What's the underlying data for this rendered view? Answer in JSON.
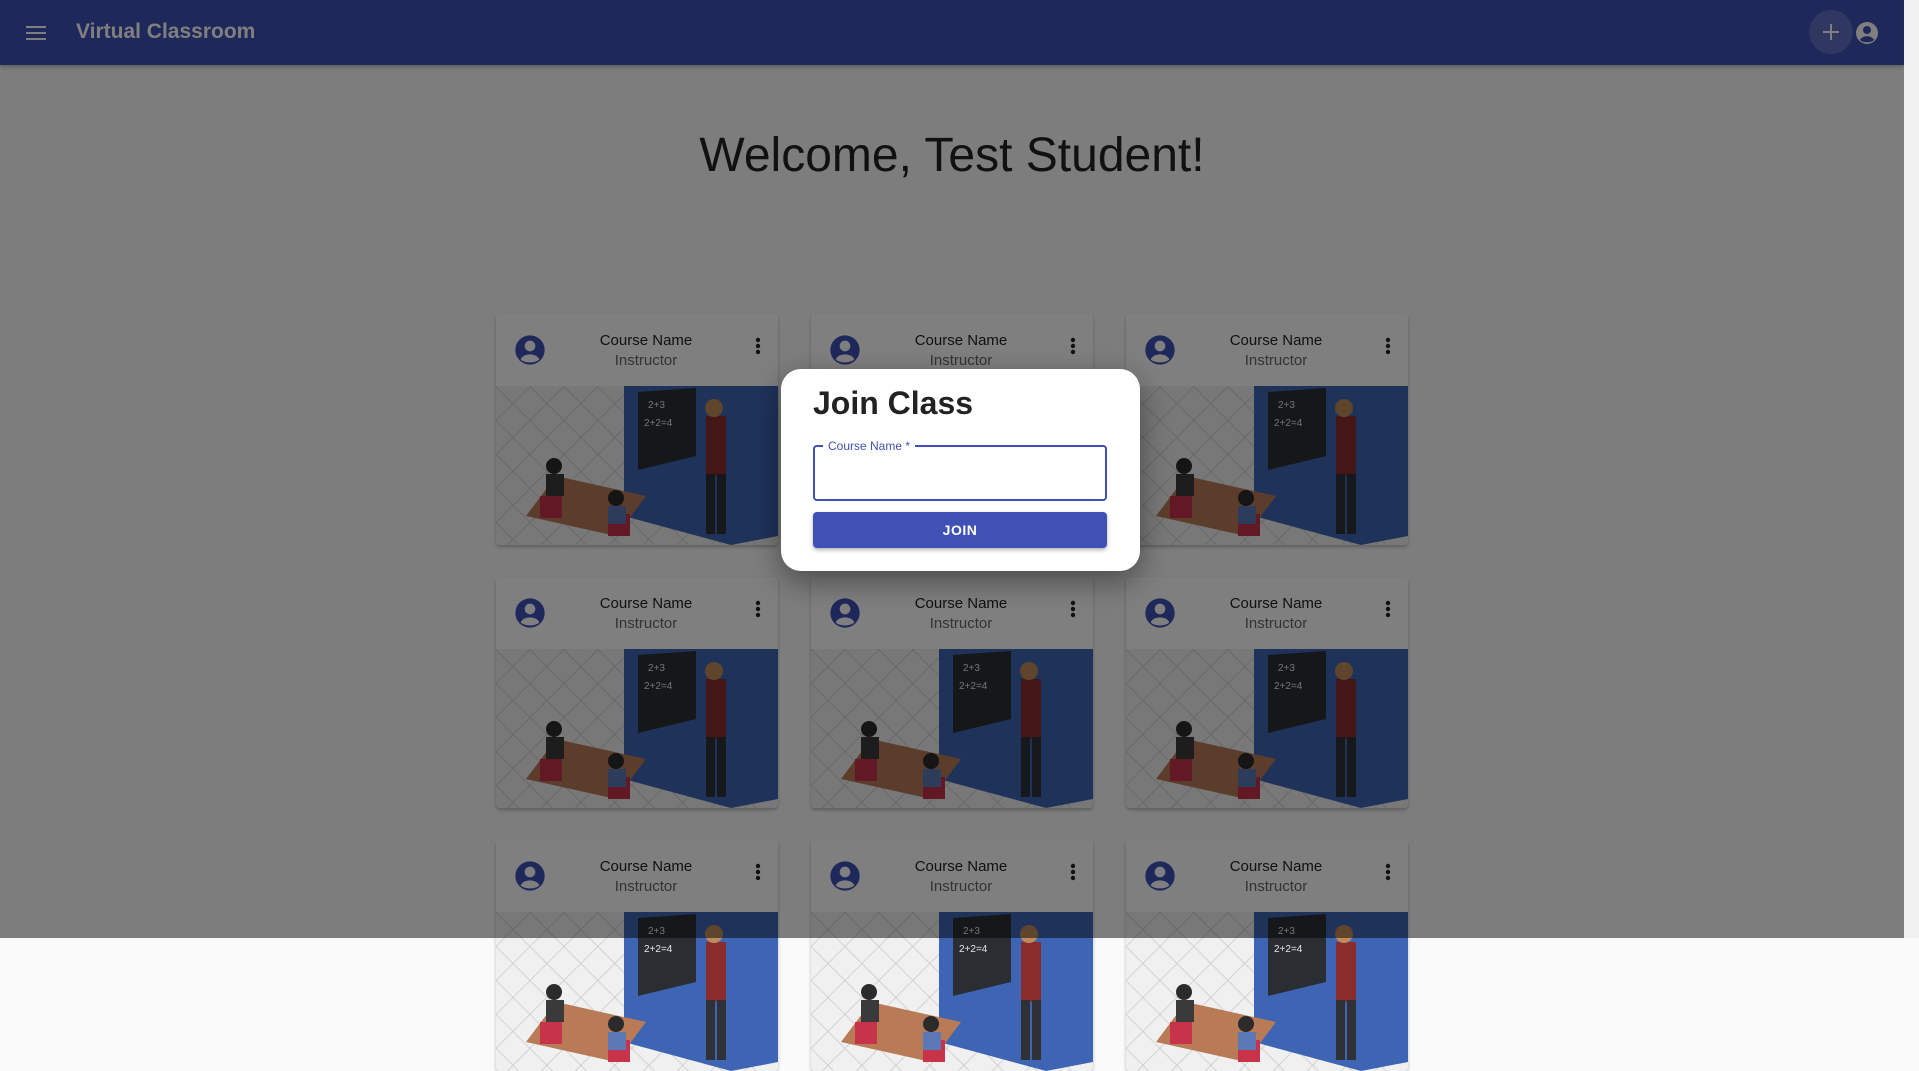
{
  "appbar": {
    "title": "Virtual Classroom",
    "menu_icon": "menu-icon",
    "add_icon": "add-icon",
    "account_icon": "account-circle-icon"
  },
  "main": {
    "welcome": "Welcome, Test Student!"
  },
  "cards": [
    {
      "title": "Course Name",
      "subtitle": "Instructor"
    },
    {
      "title": "Course Name",
      "subtitle": "Instructor"
    },
    {
      "title": "Course Name",
      "subtitle": "Instructor"
    },
    {
      "title": "Course Name",
      "subtitle": "Instructor"
    },
    {
      "title": "Course Name",
      "subtitle": "Instructor"
    },
    {
      "title": "Course Name",
      "subtitle": "Instructor"
    },
    {
      "title": "Course Name",
      "subtitle": "Instructor"
    },
    {
      "title": "Course Name",
      "subtitle": "Instructor"
    },
    {
      "title": "Course Name",
      "subtitle": "Instructor"
    }
  ],
  "dialog": {
    "title": "Join Class",
    "field_label": "Course Name *",
    "field_value": "",
    "join_label": "JOIN"
  },
  "colors": {
    "primary": "#3f51b5",
    "overlay": "rgba(0,0,0,0.5)"
  }
}
